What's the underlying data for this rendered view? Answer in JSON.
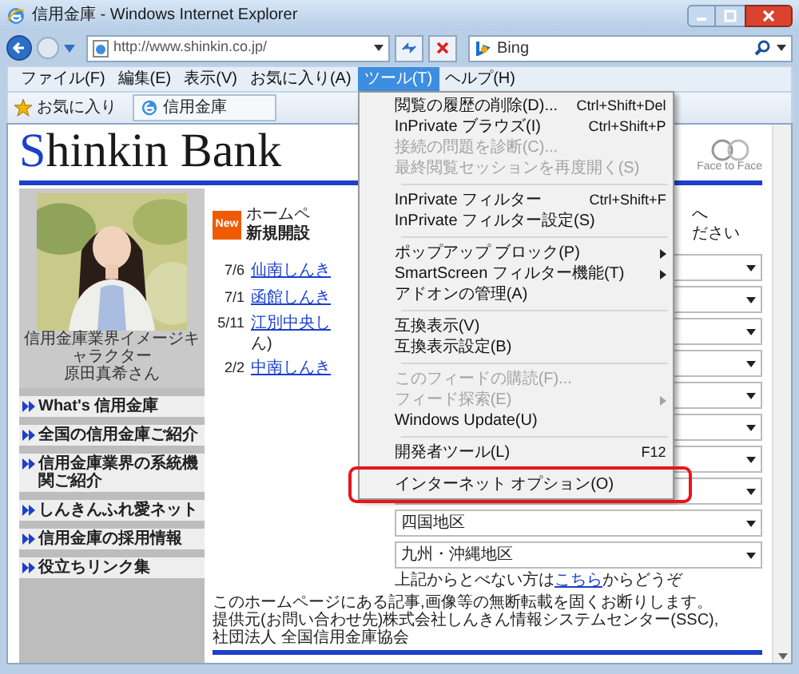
{
  "window": {
    "title": "信用金庫 - Windows Internet Explorer"
  },
  "address_bar": {
    "url": "http://www.shinkin.co.jp/"
  },
  "search": {
    "value": "Bing"
  },
  "menu_bar": [
    {
      "label": "ファイル(F)",
      "selected": false
    },
    {
      "label": "編集(E)",
      "selected": false
    },
    {
      "label": "表示(V)",
      "selected": false
    },
    {
      "label": "お気に入り(A)",
      "selected": false
    },
    {
      "label": "ツール(T)",
      "selected": true
    },
    {
      "label": "ヘルプ(H)",
      "selected": false
    }
  ],
  "favorites_bar": {
    "favorites": "お気に入り",
    "tab": "信用金庫"
  },
  "tools_menu": [
    {
      "kind": "item",
      "label": "閲覧の履歴の削除(D)...",
      "shortcut": "Ctrl+Shift+Del",
      "disabled": false,
      "submenu": false,
      "circled": false
    },
    {
      "kind": "item",
      "label": "InPrivate ブラウズ(I)",
      "shortcut": "Ctrl+Shift+P",
      "disabled": false,
      "submenu": false,
      "circled": false
    },
    {
      "kind": "item",
      "label": "接続の問題を診断(C)...",
      "disabled": true,
      "submenu": false,
      "circled": false
    },
    {
      "kind": "item",
      "label": "最終閲覧セッションを再度開く(S)",
      "disabled": true,
      "submenu": false,
      "circled": false
    },
    {
      "kind": "separator"
    },
    {
      "kind": "item",
      "label": "InPrivate フィルター",
      "shortcut": "Ctrl+Shift+F",
      "disabled": false,
      "submenu": false,
      "circled": false
    },
    {
      "kind": "item",
      "label": "InPrivate フィルター設定(S)",
      "disabled": false,
      "submenu": false,
      "circled": false
    },
    {
      "kind": "separator"
    },
    {
      "kind": "item",
      "label": "ポップアップ ブロック(P)",
      "disabled": false,
      "submenu": true,
      "circled": false
    },
    {
      "kind": "item",
      "label": "SmartScreen フィルター機能(T)",
      "disabled": false,
      "submenu": true,
      "circled": false
    },
    {
      "kind": "item",
      "label": "アドオンの管理(A)",
      "disabled": false,
      "submenu": false,
      "circled": false
    },
    {
      "kind": "separator"
    },
    {
      "kind": "item",
      "label": "互換表示(V)",
      "disabled": false,
      "submenu": false,
      "circled": false
    },
    {
      "kind": "item",
      "label": "互換表示設定(B)",
      "disabled": false,
      "submenu": false,
      "circled": false
    },
    {
      "kind": "separator"
    },
    {
      "kind": "item",
      "label": "このフィードの購読(F)...",
      "disabled": true,
      "submenu": false,
      "circled": false
    },
    {
      "kind": "item",
      "label": "フィード探索(E)",
      "disabled": true,
      "submenu": true,
      "circled": false
    },
    {
      "kind": "item",
      "label": "Windows Update(U)",
      "disabled": false,
      "submenu": false,
      "circled": false
    },
    {
      "kind": "separator"
    },
    {
      "kind": "item",
      "label": "開発者ツール(L)",
      "shortcut": "F12",
      "disabled": false,
      "submenu": false,
      "circled": false
    },
    {
      "kind": "separator"
    },
    {
      "kind": "item",
      "label": "インターネット オプション(O)",
      "disabled": false,
      "submenu": false,
      "circled": true
    }
  ],
  "page": {
    "logo": "Shinkin Bank",
    "face_logo": "Face to Face",
    "photo_caption": [
      "信用金庫業界イメージキャラクター",
      "原田真希さん"
    ],
    "nav": [
      "What's 信用金庫",
      "全国の信用金庫ご紹介",
      "信用金庫業界の系統機関ご紹介",
      "しんきんふれ愛ネット",
      "信用金庫の採用情報",
      "役立ちリンク集"
    ],
    "headline": {
      "badge": "New",
      "lines": [
        "ホームペ",
        "新規開設"
      ]
    },
    "side_text": [
      "へ",
      "ださい"
    ],
    "news": [
      {
        "date": "7/6",
        "link": "仙南しんき"
      },
      {
        "date": "7/1",
        "link": "函館しんき"
      },
      {
        "date": "5/11",
        "link": "江別中央し",
        "continuation": "ん)"
      },
      {
        "date": "2/2",
        "link": "中南しんき"
      }
    ],
    "region_selects": [
      {
        "kind": "covered"
      },
      {
        "kind": "covered"
      },
      {
        "kind": "covered"
      },
      {
        "kind": "covered"
      },
      {
        "kind": "covered"
      },
      {
        "kind": "covered"
      },
      {
        "kind": "covered"
      },
      {
        "kind": "covered"
      },
      {
        "kind": "option",
        "label": "四国地区"
      },
      {
        "kind": "option",
        "label": "九州・沖縄地区"
      }
    ],
    "fallback": {
      "before": "上記からとべない方は",
      "link": "こちら",
      "after": "からどうぞ"
    },
    "footer": [
      "このホームページにある記事,画像等の無断転載を固くお断りします。",
      "提供元(お問い合わせ先)株式会社しんきん情報システムセンター(SSC),社団法人 全国信用金庫協会"
    ]
  }
}
